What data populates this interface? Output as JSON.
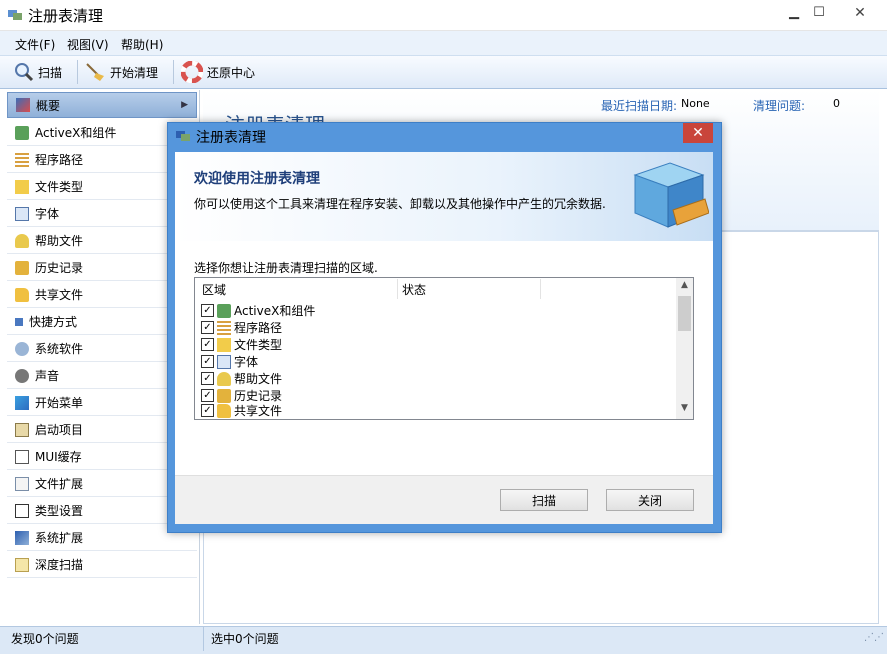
{
  "window": {
    "title": "注册表清理",
    "minimize_glyph": "▁",
    "maximize_glyph": "☐",
    "close_glyph": "✕"
  },
  "menu": [
    "文件(F)",
    "视图(V)",
    "帮助(H)"
  ],
  "toolbar": [
    {
      "label": "扫描",
      "icon": "magnifier-icon"
    },
    {
      "label": "开始清理",
      "icon": "broom-icon"
    },
    {
      "label": "还原中心",
      "icon": "lifebuoy-icon"
    }
  ],
  "sidebar": {
    "items": [
      {
        "label": "概要",
        "icon": "overview-icon",
        "selected": true,
        "caret": "▶"
      },
      {
        "label": "ActiveX和组件",
        "icon": "activex-icon"
      },
      {
        "label": "程序路径",
        "icon": "program-path-icon"
      },
      {
        "label": "文件类型",
        "icon": "file-type-icon"
      },
      {
        "label": "字体",
        "icon": "font-icon"
      },
      {
        "label": "帮助文件",
        "icon": "help-file-icon"
      },
      {
        "label": "历史记录",
        "icon": "history-icon"
      },
      {
        "label": "共享文件",
        "icon": "shared-folder-icon"
      },
      {
        "label": "快捷方式",
        "icon": "shortcut-icon"
      },
      {
        "label": "系统软件",
        "icon": "system-software-icon"
      },
      {
        "label": "声音",
        "icon": "sound-icon"
      },
      {
        "label": "开始菜单",
        "icon": "start-menu-icon"
      },
      {
        "label": "启动项目",
        "icon": "startup-icon"
      },
      {
        "label": "MUI缓存",
        "icon": "mui-cache-icon"
      },
      {
        "label": "文件扩展",
        "icon": "file-extension-icon"
      },
      {
        "label": "类型设置",
        "icon": "type-settings-icon"
      },
      {
        "label": "系统扩展",
        "icon": "system-extension-icon"
      },
      {
        "label": "深度扫描",
        "icon": "deep-scan-icon"
      }
    ]
  },
  "main": {
    "title": "注册表清理",
    "last_scan_label": "最近扫描日期:",
    "last_scan_value": "None",
    "issues_label": "清理问题:",
    "issues_value": "0"
  },
  "status": {
    "left": "发现0个问题",
    "right": "选中0个问题"
  },
  "dialog": {
    "title": "注册表清理",
    "close_glyph": "✕",
    "heading": "欢迎使用注册表清理",
    "description": "你可以使用这个工具来清理在程序安装、卸载以及其他操作中产生的冗余数据.",
    "prompt": "选择你想让注册表清理扫描的区域.",
    "columns": [
      "区域",
      "状态"
    ],
    "areas": [
      {
        "label": "ActiveX和组件",
        "checked": true,
        "icon": "activex-icon"
      },
      {
        "label": "程序路径",
        "checked": true,
        "icon": "program-path-icon"
      },
      {
        "label": "文件类型",
        "checked": true,
        "icon": "file-type-icon"
      },
      {
        "label": "字体",
        "checked": true,
        "icon": "font-icon"
      },
      {
        "label": "帮助文件",
        "checked": true,
        "icon": "help-file-icon"
      },
      {
        "label": "历史记录",
        "checked": true,
        "icon": "history-icon"
      },
      {
        "label": "共享文件",
        "checked": true,
        "icon": "shared-folder-icon"
      }
    ],
    "check_glyph": "✓",
    "scan_button": "扫描",
    "close_button": "关闭"
  }
}
